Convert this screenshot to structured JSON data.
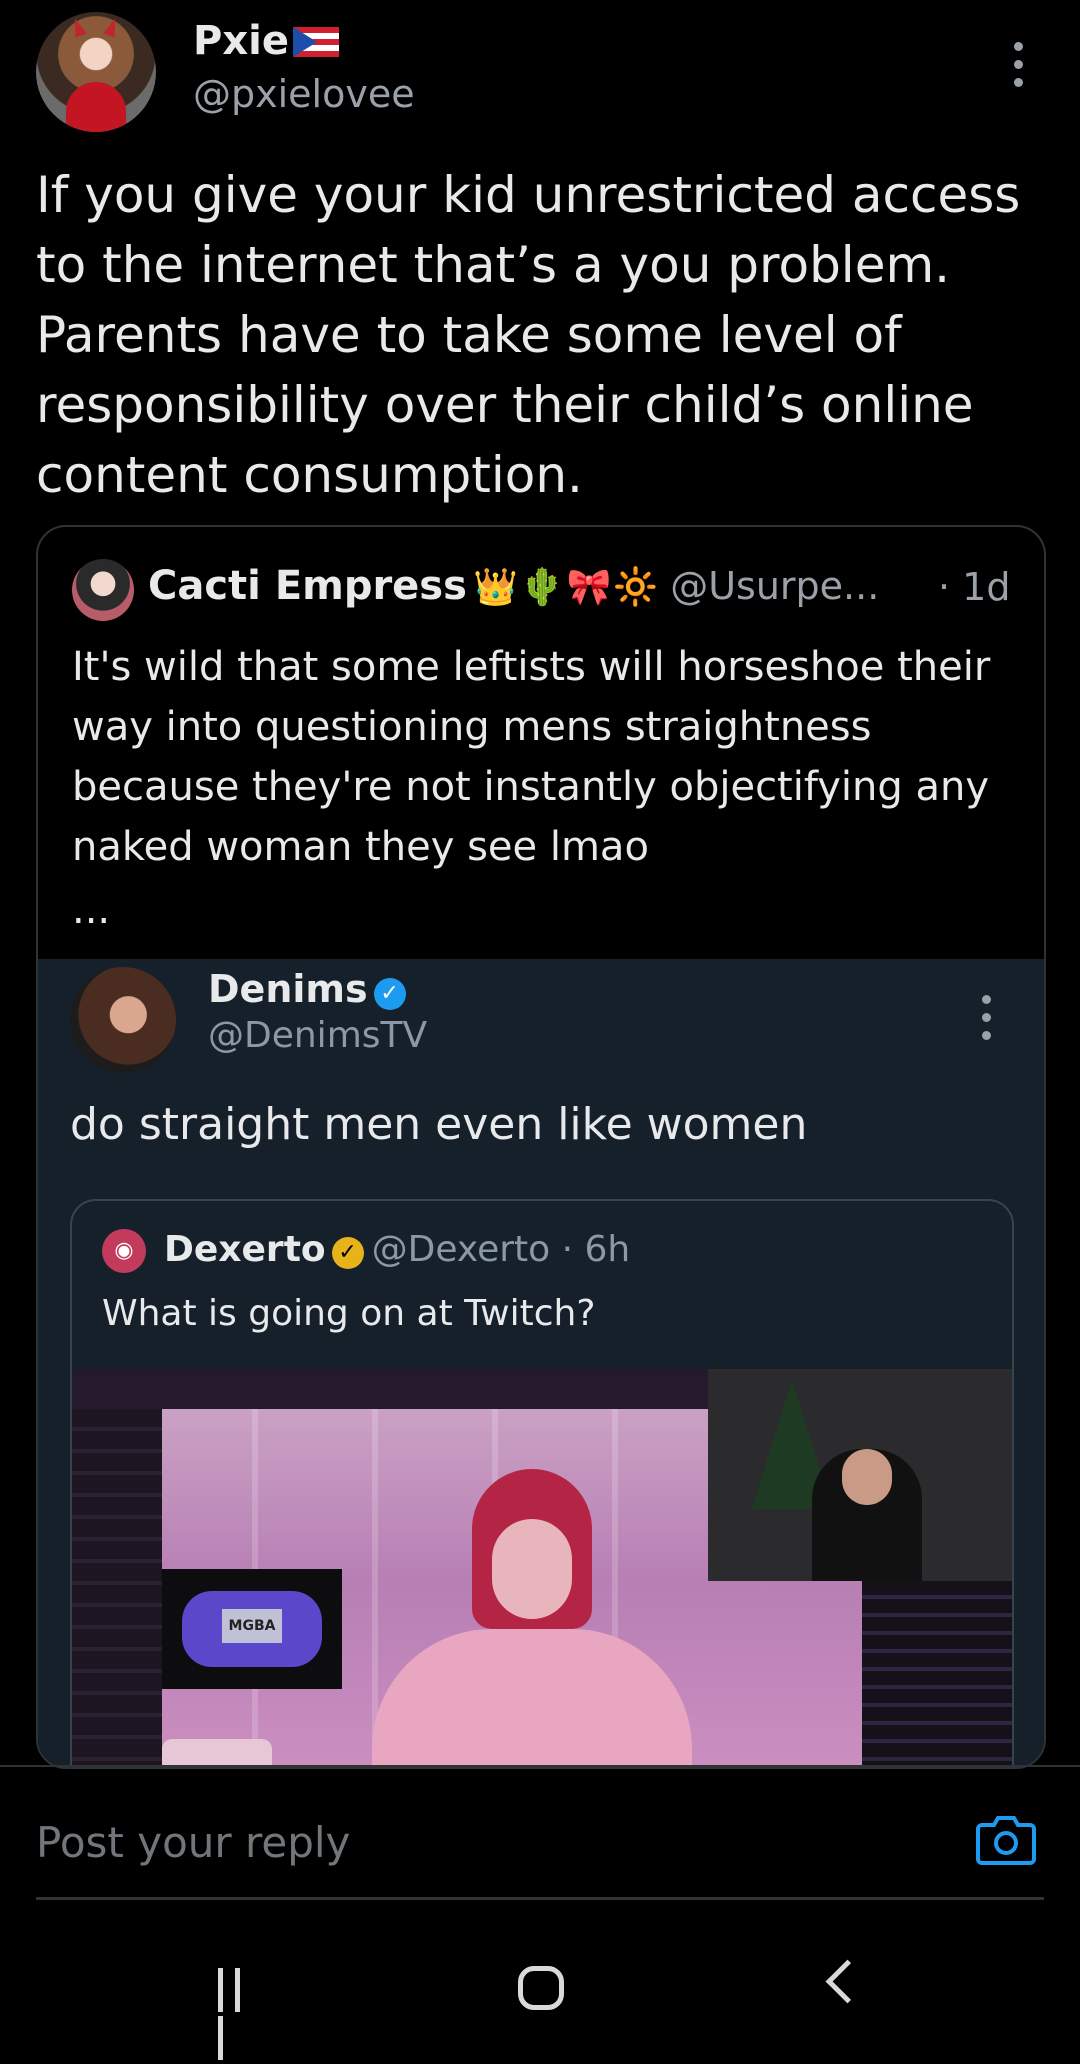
{
  "post": {
    "display_name": "Pxie",
    "handle": "@pxielovee",
    "text": "If you give your kid unrestricted access to the internet that’s a you problem. Parents have to take some level of responsibility over their child’s online content consumption."
  },
  "quote": {
    "display_name": "Cacti Empress",
    "emojis": "👑🌵🎀🔆",
    "handle": "@Usurpe...",
    "time": "· 1d",
    "text": "It's wild that some leftists will horseshoe their way into questioning mens straightness because they're not instantly objectifying any naked woman they see lmao",
    "ellipsis": "..."
  },
  "embedded": {
    "display_name": "Denims",
    "handle": "@DenimsTV",
    "text": "do straight men even like women",
    "inner": {
      "display_name": "Dexerto",
      "handle": "@Dexerto · 6h",
      "text": "What is going on at Twitch?",
      "media_gba_label": "MGBA"
    }
  },
  "reply": {
    "placeholder": "Post your reply"
  },
  "colors": {
    "background": "#000000",
    "text": "#e7e9ea",
    "muted": "#71767b",
    "accent": "#1d9bf0",
    "embed_bg": "#15202b"
  },
  "icons": {
    "more": "more-vertical-icon",
    "verified": "verified-badge-icon",
    "camera": "camera-icon",
    "nav_recent": "recent-apps-icon",
    "nav_home": "home-icon",
    "nav_back": "back-icon"
  }
}
